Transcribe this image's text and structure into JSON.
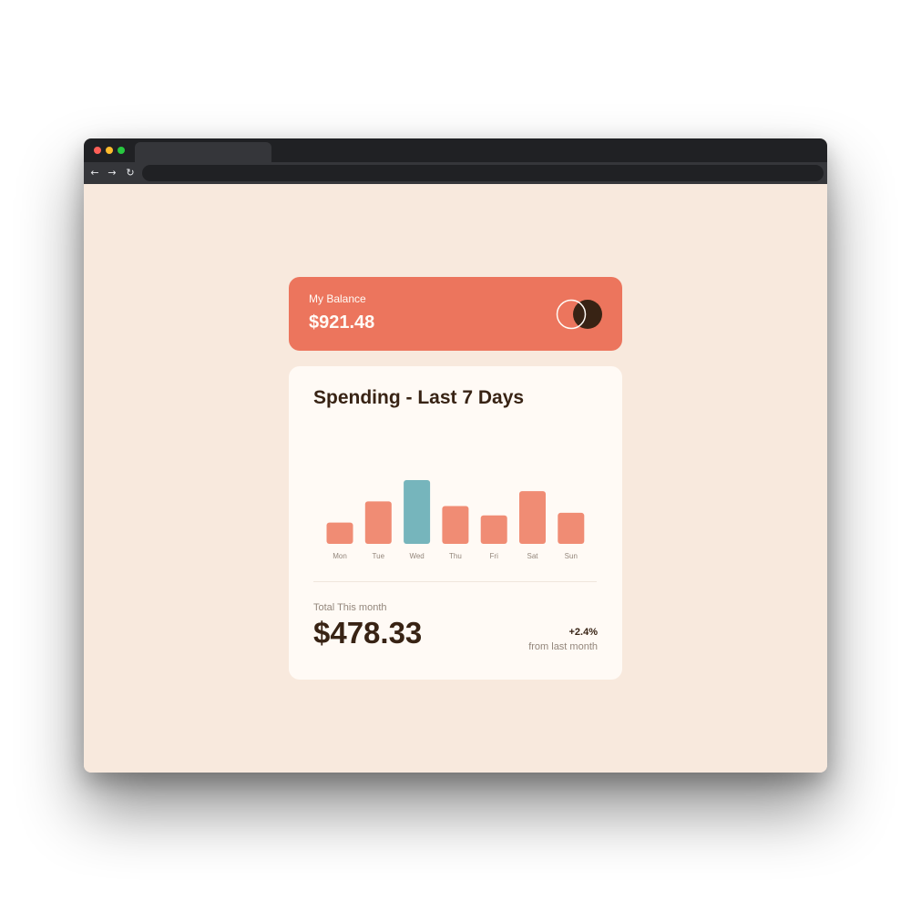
{
  "browser": {
    "back_icon": "arrow-left-icon",
    "forward_icon": "arrow-right-icon",
    "reload_icon": "reload-icon",
    "back_glyph": "←",
    "forward_glyph": "→",
    "reload_glyph": "↻"
  },
  "balance": {
    "label": "My Balance",
    "amount": "$921.48",
    "logo_icon": "two-circles-logo-icon"
  },
  "spending": {
    "title": "Spending - Last 7 Days",
    "total_label": "Total This month",
    "total_amount": "$478.33",
    "change_percent": "+2.4%",
    "change_caption": "from last month"
  },
  "colors": {
    "background": "#f8e9dd",
    "balance_card": "#ec755d",
    "bar": "#ec755d",
    "bar_highlight": "#76b5bc",
    "dark_text": "#382314",
    "muted_text": "#93867b",
    "card": "#fffaf5"
  },
  "chart_data": {
    "type": "bar",
    "categories": [
      "Mon",
      "Tue",
      "Wed",
      "Thu",
      "Fri",
      "Sat",
      "Sun"
    ],
    "values": [
      17.45,
      34.91,
      52.36,
      31.07,
      23.39,
      43.28,
      25.48
    ],
    "highlight_index": 2,
    "title": "",
    "xlabel": "",
    "ylabel": "",
    "ylim": [
      0,
      52.36
    ],
    "grid": false
  }
}
